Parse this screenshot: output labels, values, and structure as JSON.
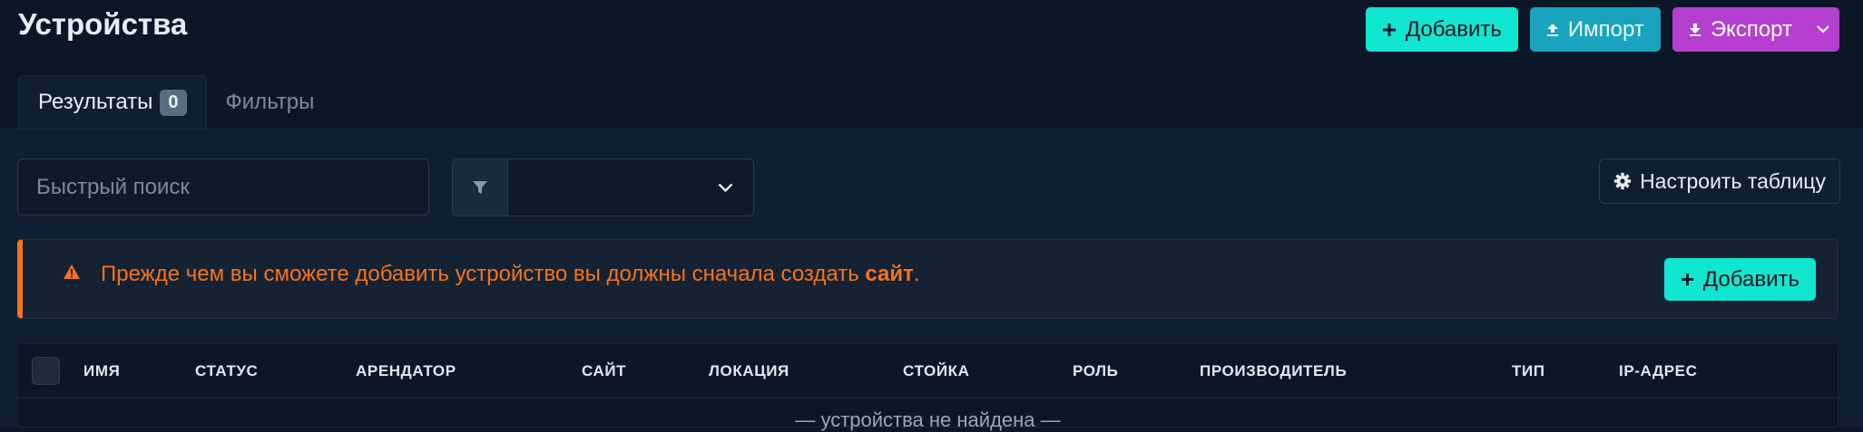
{
  "page": {
    "title": "Устройства"
  },
  "actions": {
    "add_label": "Добавить",
    "import_label": "Импорт",
    "export_label": "Экспорт"
  },
  "tabs": [
    {
      "label": "Результаты",
      "badge": "0",
      "active": true
    },
    {
      "label": "Фильтры",
      "active": false
    }
  ],
  "search": {
    "placeholder": "Быстрый поиск",
    "value": ""
  },
  "filter": {
    "selected": ""
  },
  "configure": {
    "label": "Настроить таблицу"
  },
  "alert": {
    "text_before": "Прежде чем вы сможете добавить устройство вы должны сначала создать ",
    "link_text": "сайт",
    "text_after": ".",
    "button_label": "Добавить",
    "color": "#f5731b"
  },
  "table": {
    "columns": [
      "ИМЯ",
      "СТАТУС",
      "АРЕНДАТОР",
      "САЙТ",
      "ЛОКАЦИЯ",
      "СТОЙКА",
      "РОЛЬ",
      "ПРОИЗВОДИТЕЛЬ",
      "ТИП",
      "IP-АДРЕС"
    ],
    "empty_message": "— устройства не найдена —"
  },
  "colors": {
    "background": "#0b1727",
    "add_button": "#10e6d0",
    "import_button": "#1aa3bd",
    "export_button": "#b43fd0",
    "warning": "#f5731b"
  }
}
